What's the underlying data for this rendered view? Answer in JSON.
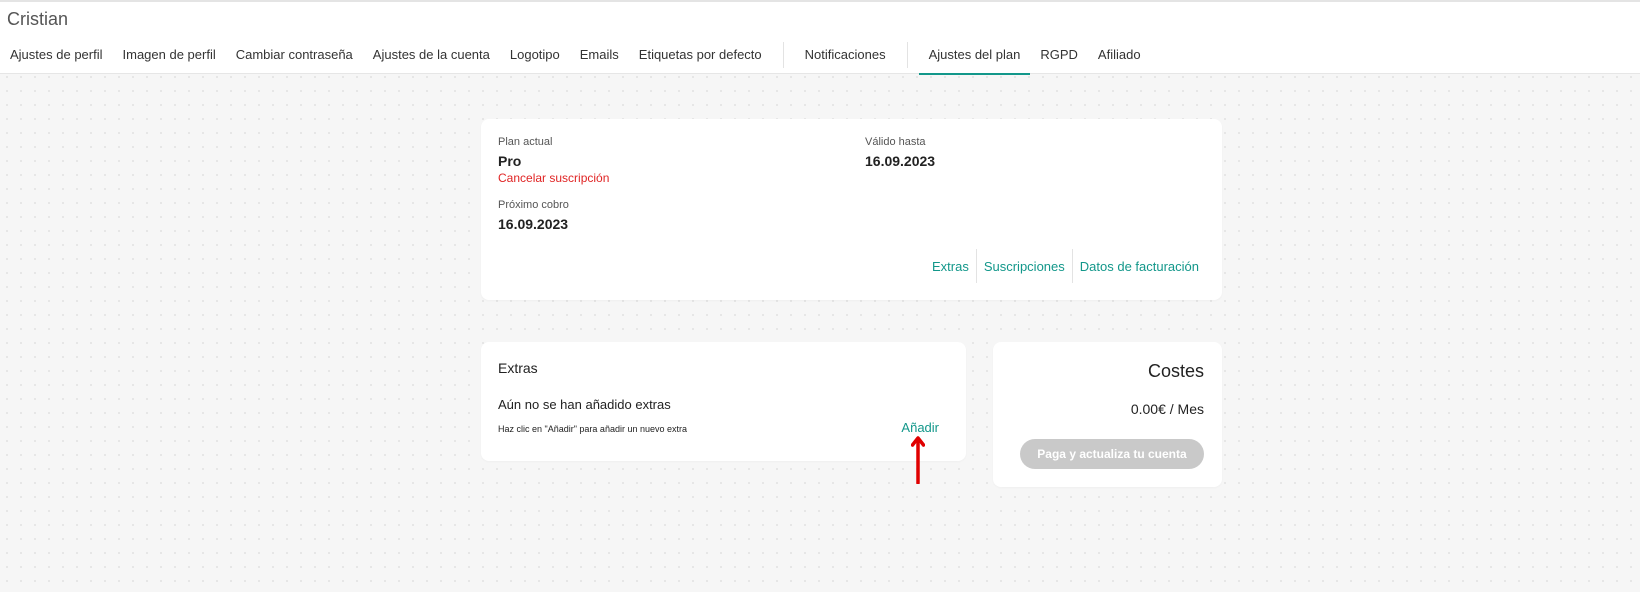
{
  "user": {
    "name": "Cristian"
  },
  "tabs": [
    {
      "label": "Ajustes de perfil"
    },
    {
      "label": "Imagen de perfil"
    },
    {
      "label": "Cambiar contraseña"
    },
    {
      "label": "Ajustes de la cuenta"
    },
    {
      "label": "Logotipo"
    },
    {
      "label": "Emails"
    },
    {
      "label": "Etiquetas por defecto"
    },
    {
      "label": "Notificaciones"
    },
    {
      "label": "Ajustes del plan",
      "active": true
    },
    {
      "label": "RGPD"
    },
    {
      "label": "Afiliado"
    }
  ],
  "plan": {
    "current_label": "Plan actual",
    "current_value": "Pro",
    "cancel_link": "Cancelar suscripción",
    "valid_label": "Válido hasta",
    "valid_value": "16.09.2023",
    "next_charge_label": "Próximo cobro",
    "next_charge_value": "16.09.2023",
    "links": {
      "extras": "Extras",
      "subscriptions": "Suscripciones",
      "billing": "Datos de facturación"
    }
  },
  "extras": {
    "title": "Extras",
    "empty_text": "Aún no se han añadido extras",
    "hint": "Haz clic en \"Añadir\" para añadir un nuevo extra",
    "add_link": "Añadir"
  },
  "costs": {
    "title": "Costes",
    "value": "0.00€ / Mes",
    "pay_button": "Paga y actualiza tu cuenta"
  },
  "colors": {
    "accent": "#12978a",
    "danger": "#e02424",
    "annotation_arrow": "#e00000",
    "disabled_button": "#c9c9c9"
  }
}
